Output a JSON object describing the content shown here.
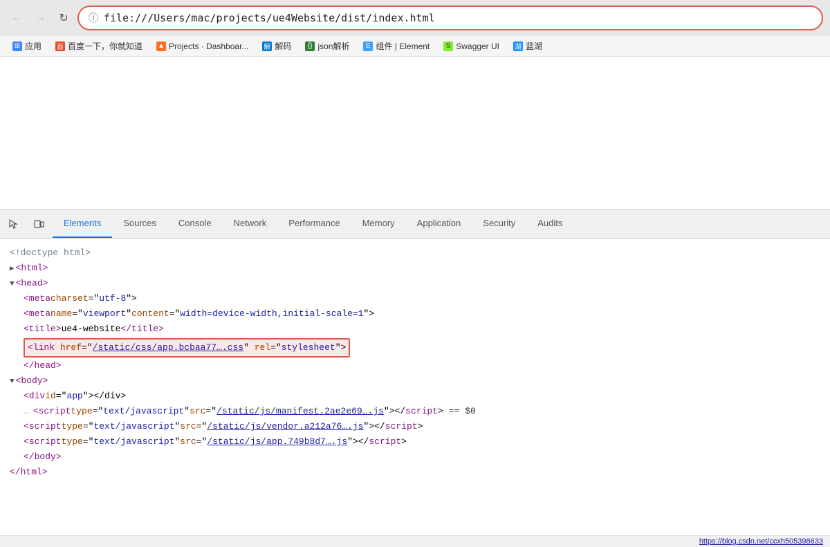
{
  "browser": {
    "address": "file:///Users/mac/projects/ue4Website/dist/index.html",
    "address_icon": "ℹ",
    "back_disabled": true,
    "forward_disabled": true
  },
  "bookmarks": [
    {
      "label": "应用",
      "icon": "⊞",
      "class": "bk-apps"
    },
    {
      "label": "百度一下，你就知道",
      "icon": "百",
      "class": "bk-baidu"
    },
    {
      "label": "Projects · Dashboar...",
      "icon": "▲",
      "class": "bk-gitlab"
    },
    {
      "label": "解码",
      "icon": "解",
      "class": "bk-lan"
    },
    {
      "label": "json解析",
      "icon": "{}",
      "class": "bk-json"
    },
    {
      "label": "组件 | Element",
      "icon": "E",
      "class": "bk-element"
    },
    {
      "label": "Swagger UI",
      "icon": "S",
      "class": "bk-swagger"
    },
    {
      "label": "蓝湖",
      "icon": "湖",
      "class": "bk-lanhub"
    }
  ],
  "devtools": {
    "tabs": [
      {
        "label": "Elements",
        "active": true
      },
      {
        "label": "Sources"
      },
      {
        "label": "Console"
      },
      {
        "label": "Network"
      },
      {
        "label": "Performance"
      },
      {
        "label": "Memory"
      },
      {
        "label": "Application"
      },
      {
        "label": "Security"
      },
      {
        "label": "Audits"
      }
    ],
    "html": {
      "doctype": "<!doctype html>",
      "html_open": "<html>",
      "head_triangle": "▼",
      "head_open": "<head>",
      "meta_charset": "<meta charset=\"utf-8\">",
      "meta_viewport_pre": "<meta name=\"viewport\" content=\"width=device-width,initial-scale=1\">",
      "title_pre": "<title>",
      "title_content": "ue4-website",
      "title_close": "</title>",
      "link_href_label": "href",
      "link_href_value": "\"/static/css/app.bcbaa77….css\"",
      "link_rel_label": "rel",
      "link_rel_value": "\"stylesheet\"",
      "head_close": "</head>",
      "body_triangle": "▼",
      "body_open": "<body>",
      "div_line": "<div id=\"app\"></div>",
      "script1_pre": "<script type=\"text/javascript\" src=\"",
      "script1_link": "/static/js/manifest.2ae2e69….js",
      "script1_post": "\"></",
      "script1_tag": "script",
      "script1_close": ">",
      "script1_equals": "== $0",
      "script2_pre": "<script type=\"text/javascript\" src=\"",
      "script2_link": "/static/js/vendor.a212a76….js",
      "script2_post": "\"></",
      "script2_tag": "script",
      "script2_close": ">",
      "script3_pre": "<script type=\"text/javascript\" src=\"",
      "script3_link": "/static/js/app.749b8d7….js",
      "script3_post": "\"></",
      "script3_tag": "script",
      "script3_close": ">",
      "body_close": "</body>",
      "html_close": "</html>"
    }
  },
  "statusbar": {
    "url": "https://blog.csdn.net/ccxh505398633"
  }
}
